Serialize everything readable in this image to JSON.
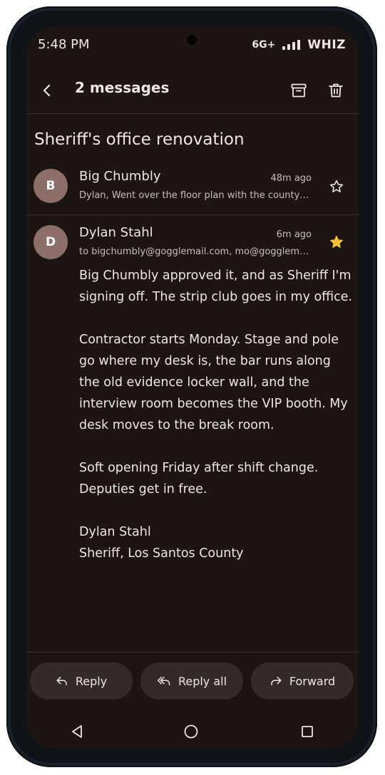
{
  "status_bar": {
    "time": "5:48 PM",
    "network": "6G+",
    "carrier": "WHIZ"
  },
  "app_bar": {
    "title": "2 messages",
    "back_icon": "arrow-back-icon",
    "archive_icon": "archive-icon",
    "delete_icon": "trash-icon"
  },
  "thread": {
    "subject": "Sheriff's office renovation",
    "messages": [
      {
        "avatar_letter": "B",
        "sender": "Big Chumbly",
        "time": "48m ago",
        "snippet": "Dylan, Went over the floor plan with the county t...",
        "starred": false
      },
      {
        "avatar_letter": "D",
        "sender": "Dylan Stahl",
        "time": "6m ago",
        "recipients": "to bigchumbly@gogglemail.com, mo@gogglema...",
        "starred": true,
        "body": [
          "Big Chumbly approved it, and as Sheriff I'm signing off. The strip club goes in my office.",
          "Contractor starts Monday. Stage and pole go where my desk is, the bar runs along the old evidence locker wall, and the interview room becomes the VIP booth. My desk moves to the break room.",
          "Soft opening Friday after shift change. Deputies get in free.",
          "Dylan Stahl\nSheriff, Los Santos County"
        ]
      }
    ]
  },
  "actions": {
    "reply": "Reply",
    "reply_all": "Reply all",
    "forward": "Forward"
  },
  "colors": {
    "background": "#1d1414",
    "avatar": "#8e6e68",
    "button_bg": "#352a2a",
    "star_active": "#f5c038",
    "text": "#efe6e4"
  }
}
